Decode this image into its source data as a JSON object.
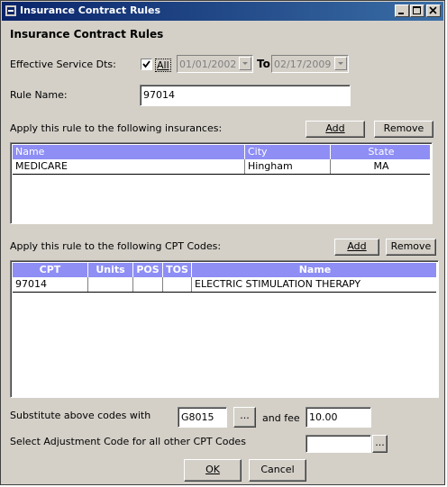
{
  "window": {
    "title": "Insurance Contract Rules"
  },
  "form": {
    "heading": "Insurance Contract Rules",
    "effective_label": "Effective Service Dts:",
    "all_label": "All",
    "all_checked": true,
    "date_from": "01/01/2002",
    "to_label": "To",
    "date_to": "02/17/2009",
    "rule_name_label": "Rule Name:",
    "rule_name_value": "97014",
    "insurances_label": "Apply this rule to the following insurances:",
    "cpt_label": "Apply this rule to the following CPT Codes:",
    "add_label": "Add",
    "remove_label": "Remove",
    "substitute_label": "Substitute above codes with",
    "substitute_value": "G8015",
    "browse_label": "...",
    "fee_label": "and fee",
    "fee_value": "10.00",
    "adjust_label": "Select Adjustment Code for all other CPT Codes",
    "adjust_value": "",
    "ok_label": "OK",
    "cancel_label": "Cancel"
  },
  "insurance_grid": {
    "columns": [
      "Name",
      "City",
      "State"
    ],
    "rows": [
      {
        "name": "MEDICARE",
        "city": "Hingham",
        "state": "MA"
      }
    ]
  },
  "cpt_grid": {
    "columns": [
      "CPT",
      "Units",
      "POS",
      "TOS",
      "Name"
    ],
    "rows": [
      {
        "cpt": "97014",
        "units": "",
        "pos": "",
        "tos": "",
        "name": "ELECTRIC STIMULATION THERAPY"
      }
    ]
  },
  "colors": {
    "titlebar": "#0a246a",
    "grid_header": "#8e8ef5",
    "face": "#d4d0c8"
  }
}
